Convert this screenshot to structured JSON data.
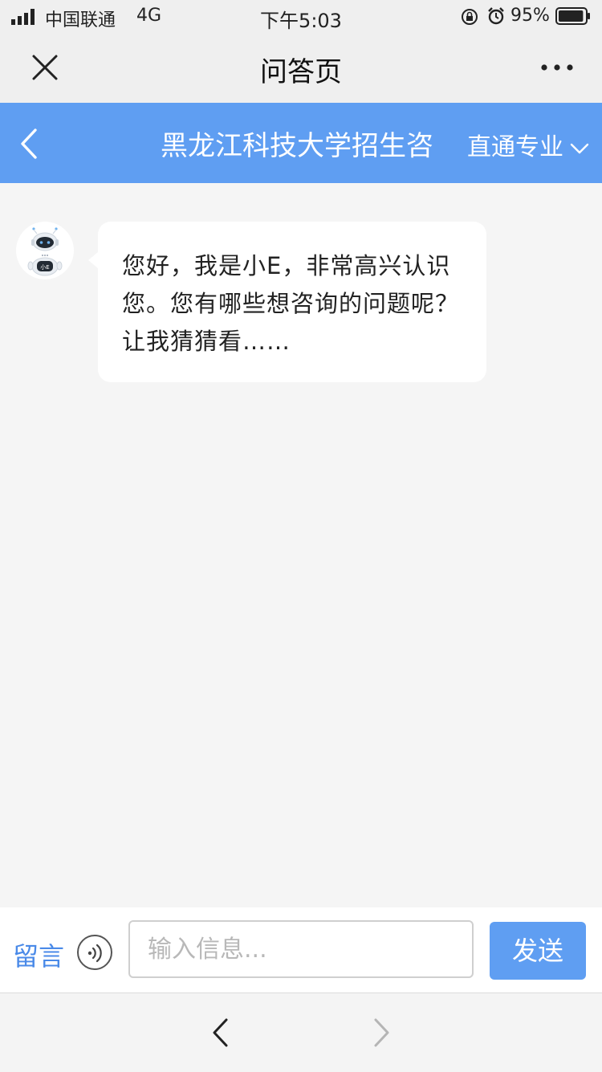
{
  "status_bar": {
    "carrier": "中国联通",
    "network": "4G",
    "time": "下午5:03",
    "battery": "95%",
    "battery_level": 0.95
  },
  "title_bar": {
    "title": "问答页",
    "close_icon": "close-icon",
    "more_icon": "more-icon"
  },
  "header": {
    "school_name": "黑龙江科技大学招生咨",
    "major_label": "直通专业",
    "background": "#5f9ef2"
  },
  "chat": {
    "messages": [
      {
        "sender": "bot",
        "text": "您好，我是小E，非常高兴认识您。您有哪些想咨询的问题呢？让我猜猜看……"
      }
    ]
  },
  "input_bar": {
    "leave_message": "留言",
    "placeholder": "输入信息...",
    "send": "发送",
    "accent": "#4a8ae8"
  }
}
